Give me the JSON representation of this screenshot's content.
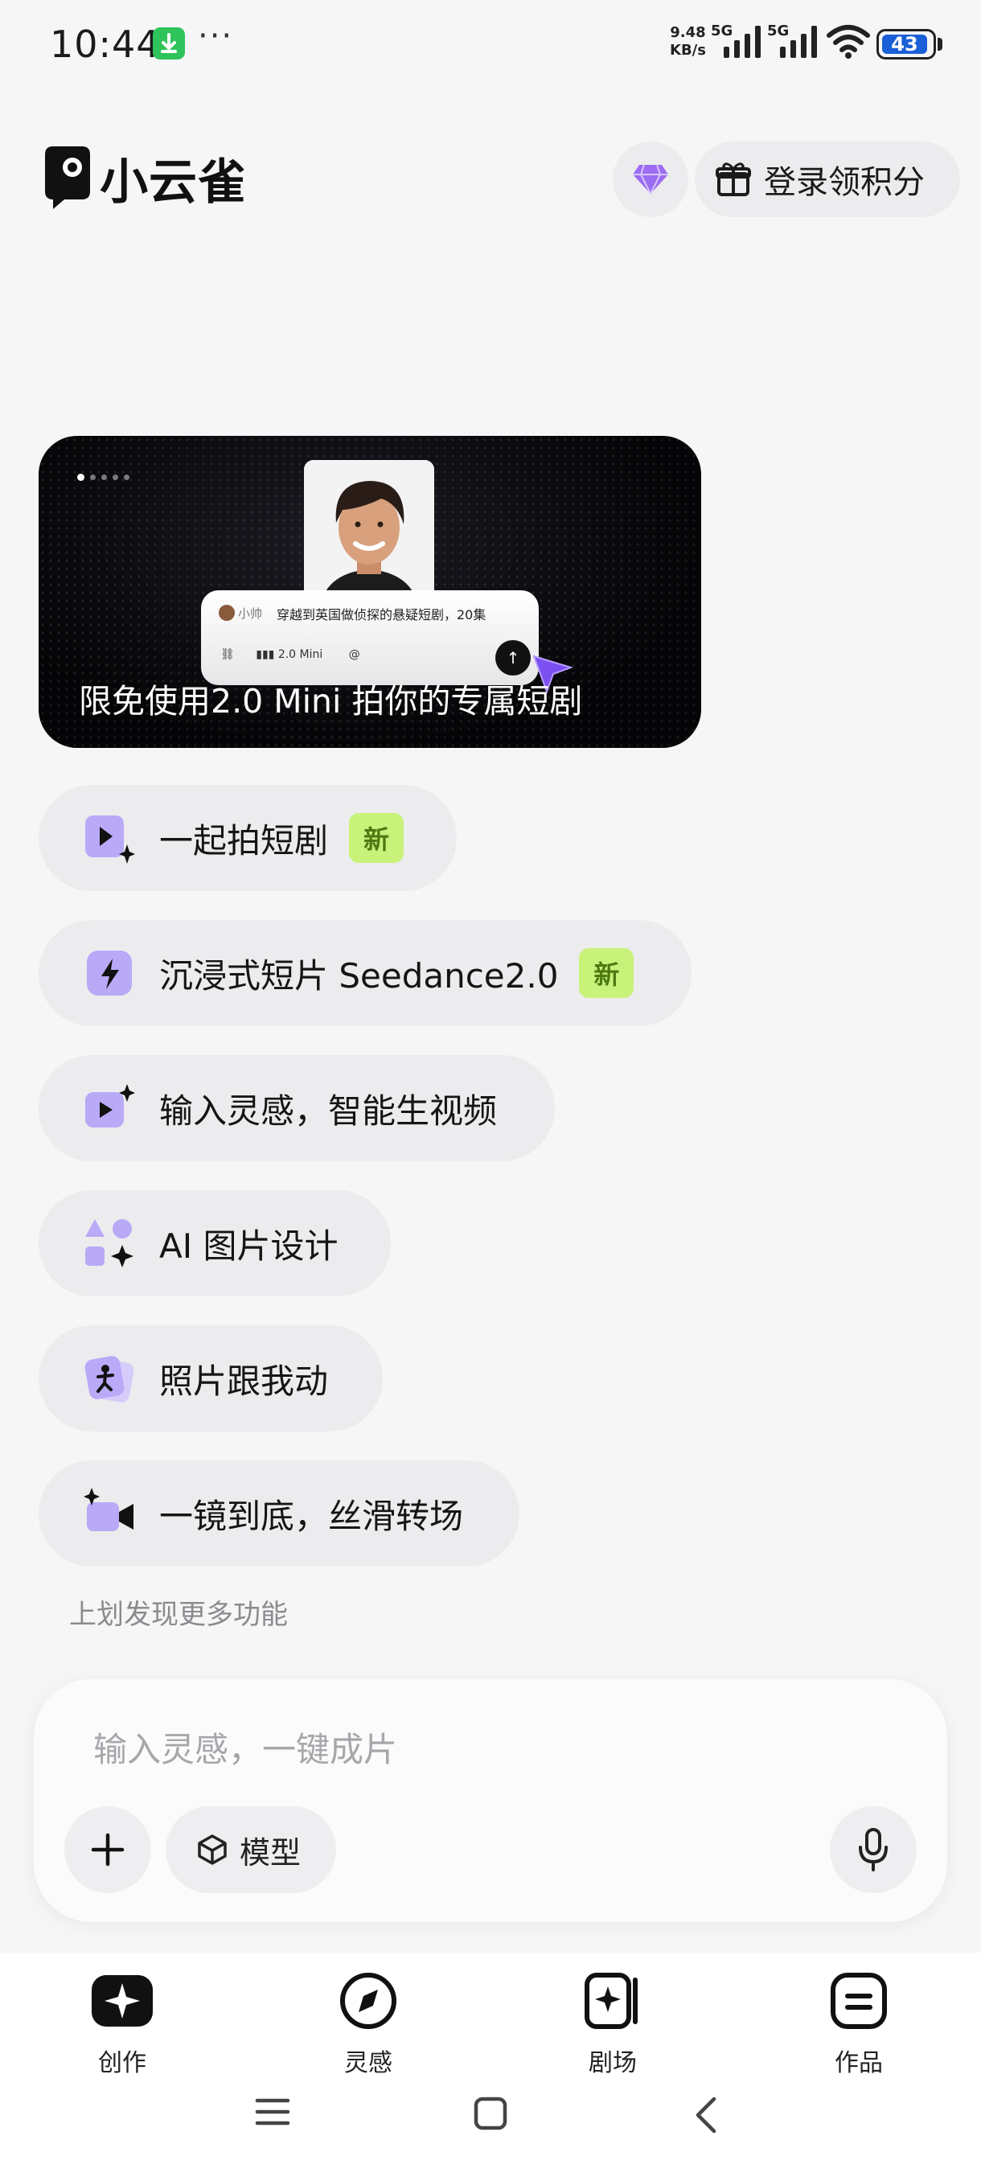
{
  "status_bar": {
    "time": "10:44",
    "more": "···",
    "net_speed_value": "9.48",
    "net_speed_unit": "KB/s",
    "sim1": "5G",
    "sim2": "5G",
    "battery": "43"
  },
  "header": {
    "app_name": "小云雀",
    "login_label": "登录领积分"
  },
  "banner": {
    "caption": "限免使用2.0 Mini 拍你的专属短剧",
    "prompt_user": "小帅",
    "prompt_text": "穿越到英国做侦探的悬疑短剧，20集",
    "model_tag": "2.0 Mini",
    "mention": "@"
  },
  "features": [
    {
      "label": "一起拍短剧",
      "badge": "新",
      "icon": "play-sparkle-icon"
    },
    {
      "label": "沉浸式短片 Seedance2.0",
      "badge": "新",
      "icon": "lightning-icon"
    },
    {
      "label": "输入灵感，智能生视频",
      "icon": "video-sparkle-icon"
    },
    {
      "label": "AI 图片设计",
      "icon": "shapes-sparkle-icon"
    },
    {
      "label": "照片跟我动",
      "icon": "photo-dance-icon"
    },
    {
      "label": "一镜到底，丝滑转场",
      "icon": "camera-sparkle-icon"
    }
  ],
  "hint": "上划发现更多功能",
  "composer": {
    "placeholder": "输入灵感，一键成片",
    "model_label": "模型"
  },
  "nav": {
    "items": [
      {
        "label": "创作"
      },
      {
        "label": "灵感"
      },
      {
        "label": "剧场"
      },
      {
        "label": "作品"
      }
    ]
  },
  "colors": {
    "accent_purple": "#b9a9f7",
    "badge_green": "#c9f27a",
    "battery_blue": "#1a5fd6"
  }
}
